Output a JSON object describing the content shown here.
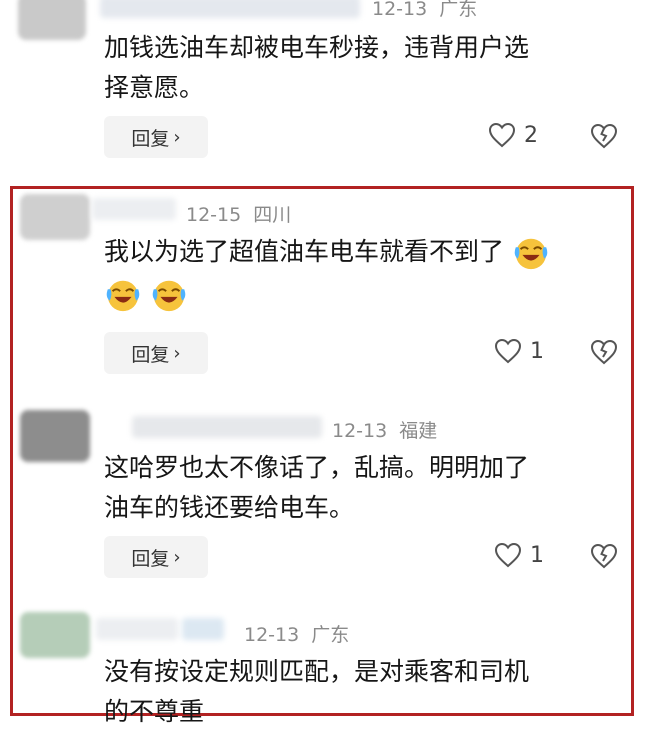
{
  "comments": [
    {
      "date": "12-13",
      "location": "广东",
      "text_line1": "加钱选油车却被电车秒接，违背用户选",
      "text_line2": "择意愿。",
      "reply_label": "回复",
      "likes": "2"
    },
    {
      "date": "12-15",
      "location": "四川",
      "text_line1": "我以为选了超值油车电车就看不到了",
      "reply_label": "回复",
      "likes": "1",
      "emoji_name": "laughing-crying-emoji"
    },
    {
      "date": "12-13",
      "location": "福建",
      "text_line1": "这哈罗也太不像话了，乱搞。明明加了",
      "text_line2": "油车的钱还要给电车。",
      "reply_label": "回复",
      "likes": "1"
    },
    {
      "date": "12-13",
      "location": "广东",
      "text_line1": "没有按设定规则匹配，是对乘客和司机",
      "text_line2": "的不尊重"
    }
  ],
  "colors": {
    "highlight_border": "#b22222",
    "meta_gray": "#8a8a8a",
    "reply_bg": "#f3f3f3"
  },
  "icons": {
    "like": "heart-outline-icon",
    "dislike": "broken-heart-icon",
    "reply_arrow": "chevron-right-icon"
  }
}
